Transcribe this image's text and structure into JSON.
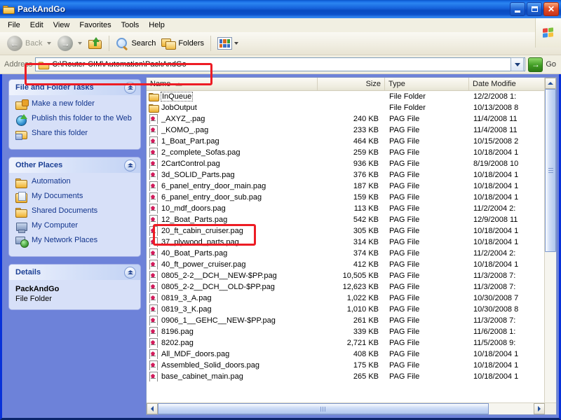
{
  "window": {
    "title": "PackAndGo",
    "title_icon": "folder-icon",
    "buttons": {
      "minimize": "minimize",
      "maximize": "maximize",
      "close": "close"
    }
  },
  "menu": {
    "items": [
      "File",
      "Edit",
      "View",
      "Favorites",
      "Tools",
      "Help"
    ],
    "logo": "windows-flag-icon"
  },
  "toolbar": {
    "back_label": "Back",
    "back_icon": "back-arrow-icon",
    "forward_icon": "forward-arrow-icon",
    "up_icon": "up-folder-icon",
    "search_label": "Search",
    "search_icon": "magnifier-icon",
    "folders_label": "Folders",
    "folders_icon": "folders-icon",
    "views_icon": "views-icon"
  },
  "address": {
    "label": "Address",
    "icon": "folder-icon",
    "value": "C:\\Router-CIM\\Automation\\PackAndGo",
    "dropdown_icon": "chevron-down-icon",
    "go_label": "Go",
    "go_icon": "green-arrow-icon"
  },
  "sidebar": {
    "panels": [
      {
        "title": "File and Folder Tasks",
        "collapse_icon": "chevron-up-icon",
        "items": [
          {
            "label": "Make a new folder",
            "icon": "new-folder-icon"
          },
          {
            "label": "Publish this folder to the Web",
            "icon": "publish-web-icon"
          },
          {
            "label": "Share this folder",
            "icon": "share-folder-icon"
          }
        ]
      },
      {
        "title": "Other Places",
        "collapse_icon": "chevron-up-icon",
        "items": [
          {
            "label": "Automation",
            "icon": "folder-icon"
          },
          {
            "label": "My Documents",
            "icon": "my-documents-icon"
          },
          {
            "label": "Shared Documents",
            "icon": "folder-icon"
          },
          {
            "label": "My Computer",
            "icon": "my-computer-icon"
          },
          {
            "label": "My Network Places",
            "icon": "network-places-icon"
          }
        ]
      },
      {
        "title": "Details",
        "collapse_icon": "chevron-up-icon",
        "detail_name": "PackAndGo",
        "detail_type": "File Folder"
      }
    ]
  },
  "filelist": {
    "columns": [
      "Name",
      "Size",
      "Type",
      "Date Modifie"
    ],
    "sort_column": "Name",
    "sort_direction": "ascending",
    "focused_row": "InQueue",
    "rows": [
      {
        "name": "InQueue",
        "size": "",
        "type": "File Folder",
        "date": "12/2/2008 1:",
        "icon": "folder-icon"
      },
      {
        "name": "JobOutput",
        "size": "",
        "type": "File Folder",
        "date": "10/13/2008 8",
        "icon": "folder-icon"
      },
      {
        "name": "_AXYZ_.pag",
        "size": "240 KB",
        "type": "PAG File",
        "date": "11/4/2008 11",
        "icon": "pag-file-icon"
      },
      {
        "name": "_KOMO_.pag",
        "size": "233 KB",
        "type": "PAG File",
        "date": "11/4/2008 11",
        "icon": "pag-file-icon"
      },
      {
        "name": "1_Boat_Part.pag",
        "size": "464 KB",
        "type": "PAG File",
        "date": "10/15/2008 2",
        "icon": "pag-file-icon"
      },
      {
        "name": "2_complete_Sofas.pag",
        "size": "259 KB",
        "type": "PAG File",
        "date": "10/18/2004 1",
        "icon": "pag-file-icon"
      },
      {
        "name": "2CartControl.pag",
        "size": "936 KB",
        "type": "PAG File",
        "date": "8/19/2008 10",
        "icon": "pag-file-icon"
      },
      {
        "name": "3d_SOLID_Parts.pag",
        "size": "376 KB",
        "type": "PAG File",
        "date": "10/18/2004 1",
        "icon": "pag-file-icon"
      },
      {
        "name": "6_panel_entry_door_main.pag",
        "size": "187 KB",
        "type": "PAG File",
        "date": "10/18/2004 1",
        "icon": "pag-file-icon"
      },
      {
        "name": "6_panel_entry_door_sub.pag",
        "size": "159 KB",
        "type": "PAG File",
        "date": "10/18/2004 1",
        "icon": "pag-file-icon"
      },
      {
        "name": "10_mdf_doors.pag",
        "size": "113 KB",
        "type": "PAG File",
        "date": "11/2/2004 2:",
        "icon": "pag-file-icon"
      },
      {
        "name": "12_Boat_Parts.pag",
        "size": "542 KB",
        "type": "PAG File",
        "date": "12/9/2008 11",
        "icon": "pag-file-icon"
      },
      {
        "name": "20_ft_cabin_cruiser.pag",
        "size": "305 KB",
        "type": "PAG File",
        "date": "10/18/2004 1",
        "icon": "pag-file-icon"
      },
      {
        "name": "37_plywood_parts.pag",
        "size": "314 KB",
        "type": "PAG File",
        "date": "10/18/2004 1",
        "icon": "pag-file-icon"
      },
      {
        "name": "40_Boat_Parts.pag",
        "size": "374 KB",
        "type": "PAG File",
        "date": "11/2/2004 2:",
        "icon": "pag-file-icon"
      },
      {
        "name": "40_ft_power_cruiser.pag",
        "size": "412 KB",
        "type": "PAG File",
        "date": "10/18/2004 1",
        "icon": "pag-file-icon"
      },
      {
        "name": "0805_2-2__DCH__NEW-$PP.pag",
        "size": "10,505 KB",
        "type": "PAG File",
        "date": "11/3/2008 7:",
        "icon": "pag-file-icon"
      },
      {
        "name": "0805_2-2__DCH__OLD-$PP.pag",
        "size": "12,623 KB",
        "type": "PAG File",
        "date": "11/3/2008 7:",
        "icon": "pag-file-icon"
      },
      {
        "name": "0819_3_A.pag",
        "size": "1,022 KB",
        "type": "PAG File",
        "date": "10/30/2008 7",
        "icon": "pag-file-icon"
      },
      {
        "name": "0819_3_K.pag",
        "size": "1,010 KB",
        "type": "PAG File",
        "date": "10/30/2008 8",
        "icon": "pag-file-icon"
      },
      {
        "name": "0906_1__GEHC__NEW-$PP.pag",
        "size": "261 KB",
        "type": "PAG File",
        "date": "11/3/2008 7:",
        "icon": "pag-file-icon"
      },
      {
        "name": "8196.pag",
        "size": "339 KB",
        "type": "PAG File",
        "date": "11/6/2008 1:",
        "icon": "pag-file-icon"
      },
      {
        "name": "8202.pag",
        "size": "2,721 KB",
        "type": "PAG File",
        "date": "11/5/2008 9:",
        "icon": "pag-file-icon"
      },
      {
        "name": "All_MDF_doors.pag",
        "size": "408 KB",
        "type": "PAG File",
        "date": "10/18/2004 1",
        "icon": "pag-file-icon"
      },
      {
        "name": "Assembled_Solid_doors.pag",
        "size": "175 KB",
        "type": "PAG File",
        "date": "10/18/2004 1",
        "icon": "pag-file-icon"
      },
      {
        "name": "base_cabinet_main.pag",
        "size": "265 KB",
        "type": "PAG File",
        "date": "10/18/2004 1",
        "icon": "pag-file-icon"
      }
    ]
  },
  "annotations": {
    "color": "#ED1C24",
    "boxes": [
      "address-bar-highlight",
      "file-12-boat-parts-highlight"
    ]
  }
}
